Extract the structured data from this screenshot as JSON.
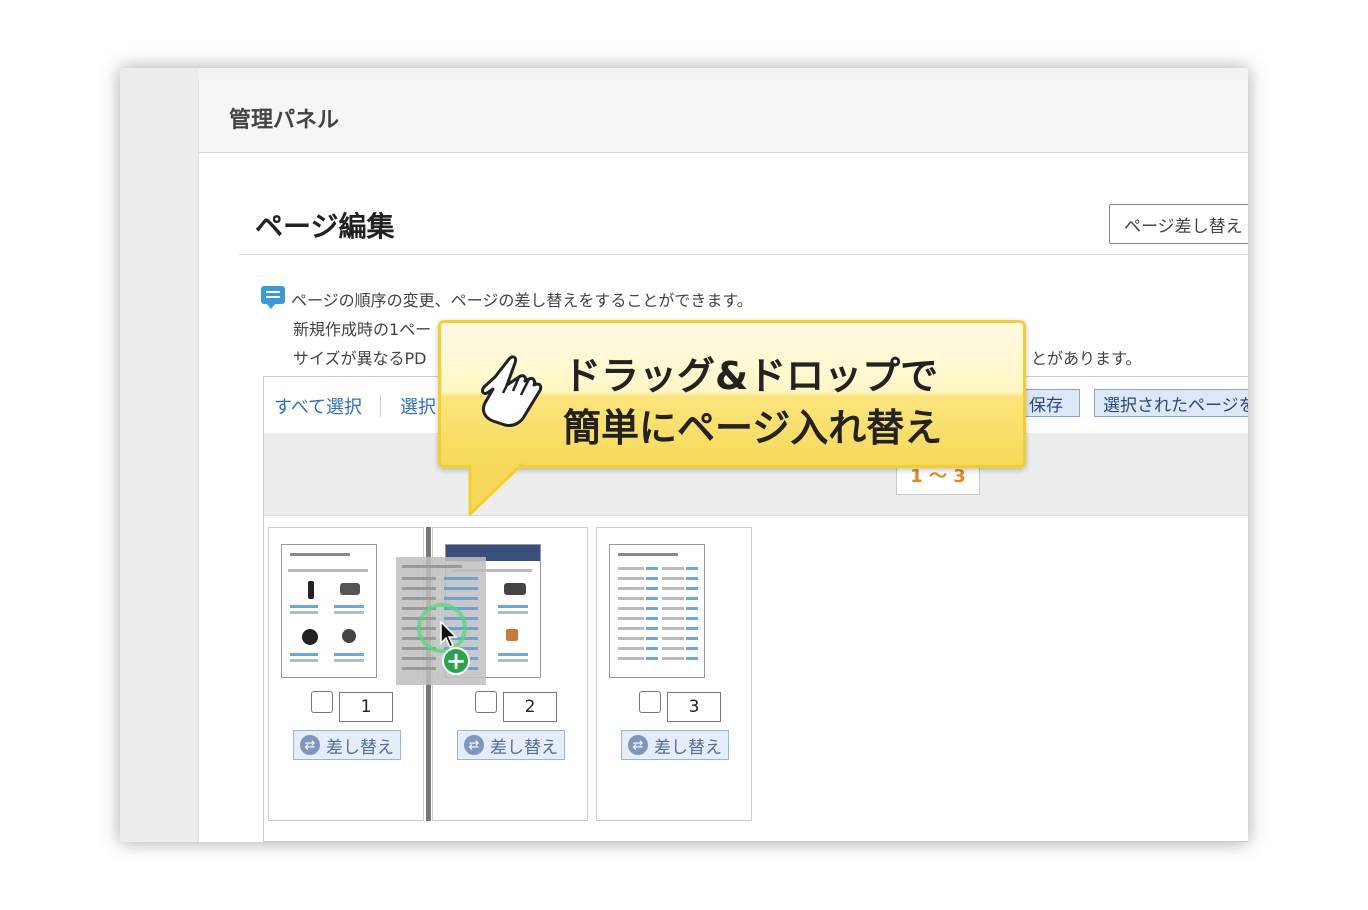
{
  "panel": {
    "title": "管理パネル"
  },
  "section": {
    "title": "ページ編集",
    "replace_button": "ページ差し替え"
  },
  "info": {
    "line1": "ページの順序の変更、ページの差し替えをすることができます。",
    "line2": "新規作成時の1ペー",
    "line3": "サイズが異なるPD",
    "line3_tail": "とがあります。"
  },
  "toolbar": {
    "select_all": "すべて選択",
    "select_partial": "選択",
    "save": "保存",
    "selected_pages": "選択されたページを"
  },
  "range_label": "1 〜 3",
  "pages": [
    {
      "number": "1",
      "replace_label": "差し替え"
    },
    {
      "number": "2",
      "replace_label": "差し替え"
    },
    {
      "number": "3",
      "replace_label": "差し替え"
    }
  ],
  "callout": {
    "line1": "ドラッグ&ドロップで",
    "line2": "簡単にページ入れ替え"
  },
  "colors": {
    "accent": "#2a6fc9",
    "callout_fill": "#fbe47b",
    "callout_border": "#f3cf2b",
    "range_text": "#e08a1c"
  },
  "icons": {
    "info": "speech-bubble-icon",
    "replace": "swap-icon",
    "callout": "pointing-hand-icon",
    "drag_add": "plus-icon"
  }
}
